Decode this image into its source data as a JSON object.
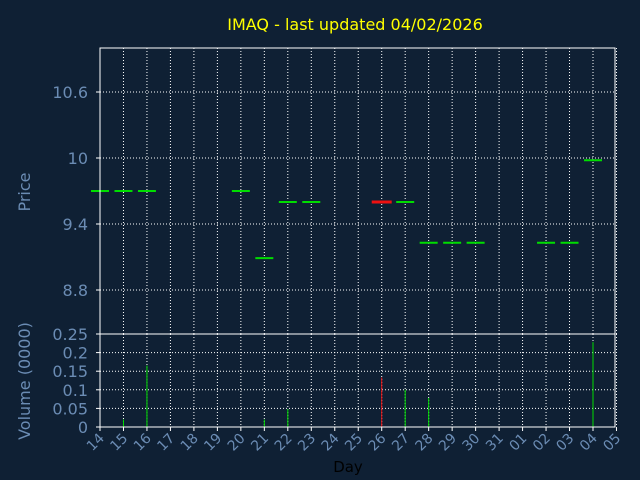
{
  "colors": {
    "background": "#0f2034",
    "axis_text": "#6b8cb4",
    "title": "#ffff00",
    "grid": "#ffffff",
    "up": "#00dd00",
    "down": "#ee1111"
  },
  "chart_data": [
    {
      "type": "candlestick",
      "title": "IMAQ - last updated 04/02/2026",
      "ylabel": "Price",
      "ylim": [
        8.4,
        11.0
      ],
      "yticks": [
        8.8,
        9.4,
        10,
        10.6
      ],
      "ytick_labels": [
        "8.8",
        "9.4",
        "10",
        "10.6"
      ],
      "grid": true,
      "categories": [
        "14",
        "15",
        "16",
        "17",
        "18",
        "19",
        "20",
        "21",
        "22",
        "23",
        "24",
        "25",
        "26",
        "27",
        "28",
        "29",
        "30",
        "31",
        "01",
        "02",
        "03",
        "04",
        "05"
      ],
      "bars": [
        {
          "day": "14",
          "price": 9.7,
          "dir": "up"
        },
        {
          "day": "15",
          "price": 9.7,
          "dir": "up"
        },
        {
          "day": "16",
          "price": 9.7,
          "dir": "up"
        },
        {
          "day": "20",
          "price": 9.7,
          "dir": "up"
        },
        {
          "day": "21",
          "price": 9.09,
          "dir": "up"
        },
        {
          "day": "22",
          "price": 9.6,
          "dir": "up"
        },
        {
          "day": "23",
          "price": 9.6,
          "dir": "up"
        },
        {
          "day": "26",
          "price": 9.6,
          "dir": "down"
        },
        {
          "day": "27",
          "price": 9.6,
          "dir": "up"
        },
        {
          "day": "28",
          "price": 9.23,
          "dir": "up"
        },
        {
          "day": "29",
          "price": 9.23,
          "dir": "up"
        },
        {
          "day": "30",
          "price": 9.23,
          "dir": "up"
        },
        {
          "day": "02",
          "price": 9.23,
          "dir": "up"
        },
        {
          "day": "03",
          "price": 9.23,
          "dir": "up"
        },
        {
          "day": "04",
          "price": 9.98,
          "dir": "up"
        }
      ]
    },
    {
      "type": "bar",
      "xlabel": "Day",
      "ylabel": "Volume (0000)",
      "ylim": [
        0,
        0.25
      ],
      "yticks": [
        0,
        0.05,
        0.1,
        0.15,
        0.2,
        0.25
      ],
      "ytick_labels": [
        "0",
        "0.05",
        "0.1",
        "0.15",
        "0.2",
        "0.25"
      ],
      "grid": true,
      "categories": [
        "14",
        "15",
        "16",
        "17",
        "18",
        "19",
        "20",
        "21",
        "22",
        "23",
        "24",
        "25",
        "26",
        "27",
        "28",
        "29",
        "30",
        "31",
        "01",
        "02",
        "03",
        "04",
        "05"
      ],
      "volumes": [
        {
          "day": "15",
          "value": 0.02,
          "dir": "up"
        },
        {
          "day": "16",
          "value": 0.165,
          "dir": "up"
        },
        {
          "day": "21",
          "value": 0.02,
          "dir": "up"
        },
        {
          "day": "22",
          "value": 0.048,
          "dir": "up"
        },
        {
          "day": "26",
          "value": 0.133,
          "dir": "down"
        },
        {
          "day": "27",
          "value": 0.1,
          "dir": "up"
        },
        {
          "day": "28",
          "value": 0.078,
          "dir": "up"
        },
        {
          "day": "04",
          "value": 0.228,
          "dir": "up"
        }
      ]
    }
  ]
}
